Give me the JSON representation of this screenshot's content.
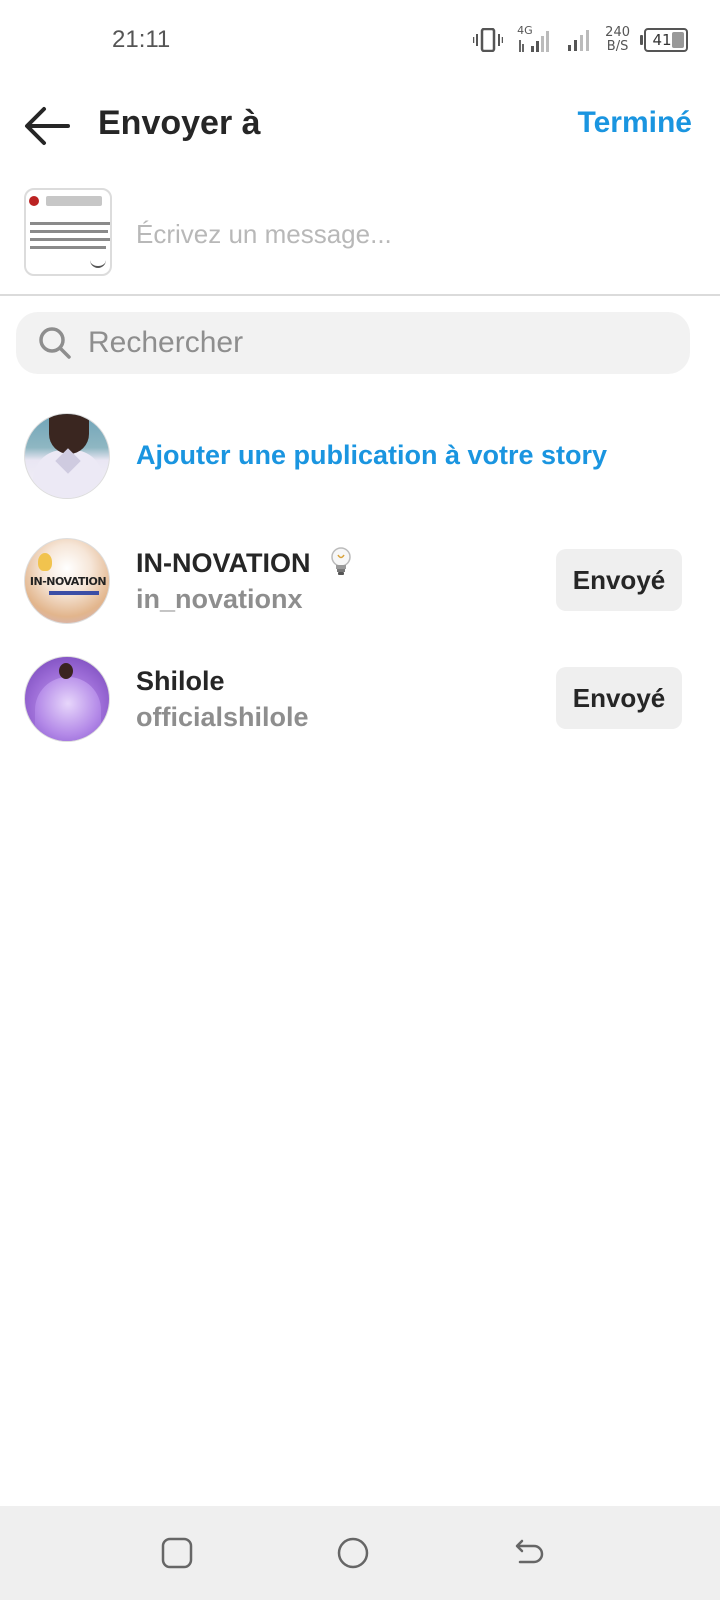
{
  "status_bar": {
    "time": "21:11",
    "network_type": "4G",
    "speed_value": "240",
    "speed_unit": "B/S",
    "battery_level": "41"
  },
  "header": {
    "back_icon": "arrow-left-icon",
    "title": "Envoyer à",
    "done_label": "Terminé"
  },
  "composer": {
    "placeholder": "Écrivez un message..."
  },
  "search": {
    "icon": "search-icon",
    "placeholder": "Rechercher"
  },
  "story": {
    "label": "Ajouter une publication à votre story"
  },
  "contacts": [
    {
      "name": "IN-NOVATION",
      "name_emoji": "lightbulb-icon",
      "handle": "in_novationx",
      "action_label": "Envoyé"
    },
    {
      "name": "Shilole",
      "handle": "officialshilole",
      "action_label": "Envoyé"
    }
  ],
  "avatars": {
    "innovation_logo_text": "IN-NOVATION"
  },
  "nav_bar": {
    "icons": [
      "recent-apps-icon",
      "home-icon",
      "back-icon"
    ]
  },
  "colors": {
    "accent": "#1a95e0",
    "text": "#262626",
    "secondary_text": "#8e8e8e",
    "button_bg": "#efefef"
  }
}
